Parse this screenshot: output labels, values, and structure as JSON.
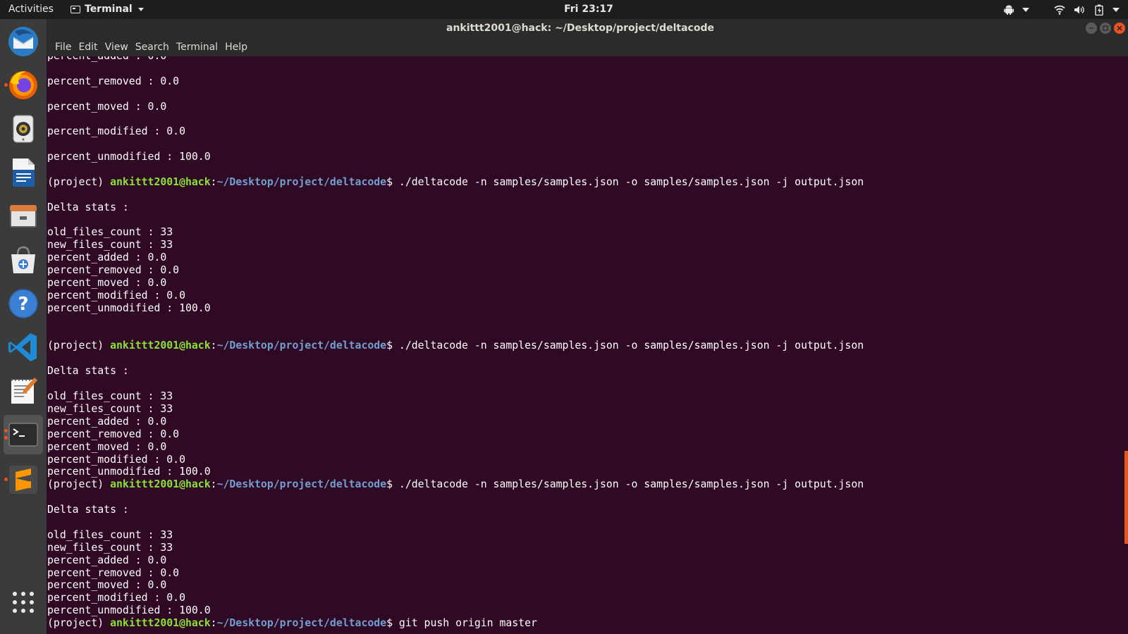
{
  "topbar": {
    "activities": "Activities",
    "app_menu": "Terminal",
    "clock": "Fri 23:17"
  },
  "dock": {
    "apps": [
      "thunderbird-icon",
      "firefox-icon",
      "rhythmbox-icon",
      "libreoffice-writer-icon",
      "files-icon",
      "software-center-icon",
      "help-icon",
      "vscode-icon",
      "text-editor-icon",
      "terminal-icon",
      "sublime-text-icon",
      "show-applications-icon"
    ]
  },
  "window": {
    "title": "ankittt2001@hack: ~/Desktop/project/deltacode"
  },
  "menubar": {
    "file": "File",
    "edit": "Edit",
    "view": "View",
    "search": "Search",
    "terminal": "Terminal",
    "help": "Help"
  },
  "terminal": {
    "prompt": {
      "env": "(project) ",
      "user_host": "ankittt2001@hack",
      "sep": ":",
      "path": "~/Desktop/project/deltacode",
      "dollar": "$ "
    },
    "lines": [
      {
        "text": "percent_added : 0.0"
      },
      {
        "text": ""
      },
      {
        "text": "percent_removed : 0.0"
      },
      {
        "text": ""
      },
      {
        "text": "percent_moved : 0.0"
      },
      {
        "text": ""
      },
      {
        "text": "percent_modified : 0.0"
      },
      {
        "text": ""
      },
      {
        "text": "percent_unmodified : 100.0"
      },
      {
        "text": ""
      },
      {
        "prompt": true,
        "cmd": "./deltacode -n samples/samples.json -o samples/samples.json -j output.json"
      },
      {
        "text": ""
      },
      {
        "text": "Delta stats :"
      },
      {
        "text": ""
      },
      {
        "text": "old_files_count : 33"
      },
      {
        "text": "new_files_count : 33"
      },
      {
        "text": "percent_added : 0.0"
      },
      {
        "text": "percent_removed : 0.0"
      },
      {
        "text": "percent_moved : 0.0"
      },
      {
        "text": "percent_modified : 0.0"
      },
      {
        "text": "percent_unmodified : 100.0"
      },
      {
        "text": ""
      },
      {
        "text": ""
      },
      {
        "prompt": true,
        "cmd": "./deltacode -n samples/samples.json -o samples/samples.json -j output.json"
      },
      {
        "text": ""
      },
      {
        "text": "Delta stats :"
      },
      {
        "text": ""
      },
      {
        "text": "old_files_count : 33"
      },
      {
        "text": "new_files_count : 33"
      },
      {
        "text": "percent_added : 0.0"
      },
      {
        "text": "percent_removed : 0.0"
      },
      {
        "text": "percent_moved : 0.0"
      },
      {
        "text": "percent_modified : 0.0"
      },
      {
        "text": "percent_unmodified : 100.0"
      },
      {
        "prompt": true,
        "cmd": "./deltacode -n samples/samples.json -o samples/samples.json -j output.json"
      },
      {
        "text": ""
      },
      {
        "text": "Delta stats :"
      },
      {
        "text": ""
      },
      {
        "text": "old_files_count : 33"
      },
      {
        "text": "new_files_count : 33"
      },
      {
        "text": "percent_added : 0.0"
      },
      {
        "text": "percent_removed : 0.0"
      },
      {
        "text": "percent_moved : 0.0"
      },
      {
        "text": "percent_modified : 0.0"
      },
      {
        "text": "percent_unmodified : 100.0"
      },
      {
        "prompt": true,
        "cmd": "git push origin master"
      }
    ]
  },
  "colors": {
    "terminal_bg": "#300a24",
    "prompt_user": "#8ae234",
    "prompt_path": "#729fcf",
    "accent": "#e95420"
  }
}
